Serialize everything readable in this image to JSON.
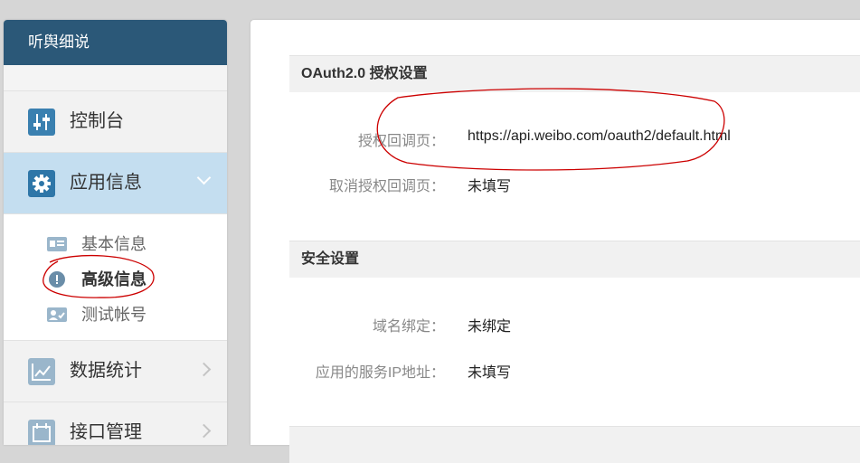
{
  "sidebar": {
    "app_name": "听舆细说",
    "nav": {
      "dashboard": {
        "label": "控制台",
        "icon": "sliders-icon"
      },
      "app_info": {
        "label": "应用信息",
        "icon": "gear-icon"
      },
      "stats": {
        "label": "数据统计",
        "icon": "line-chart-icon"
      },
      "api": {
        "label": "接口管理",
        "icon": "calendar-icon"
      }
    },
    "submenu": [
      {
        "label": "基本信息",
        "icon": "id-card-icon"
      },
      {
        "label": "高级信息",
        "icon": "exclamation-icon"
      },
      {
        "label": "测试帐号",
        "icon": "user-card-icon"
      }
    ]
  },
  "main": {
    "oauth": {
      "title": "OAuth2.0 授权设置",
      "callback_label": "授权回调页：",
      "callback_value": "https://api.weibo.com/oauth2/default.html",
      "cancel_label": "取消授权回调页：",
      "cancel_value": "未填写"
    },
    "security": {
      "title": "安全设置",
      "domain_label": "域名绑定：",
      "domain_value": "未绑定",
      "ip_label": "应用的服务IP地址：",
      "ip_value": "未填写"
    }
  },
  "colors": {
    "header_bg": "#2b5878",
    "active_nav_bg": "#c4def0",
    "icon_blue": "#3a80b0",
    "annotation_red": "#cc0000"
  }
}
